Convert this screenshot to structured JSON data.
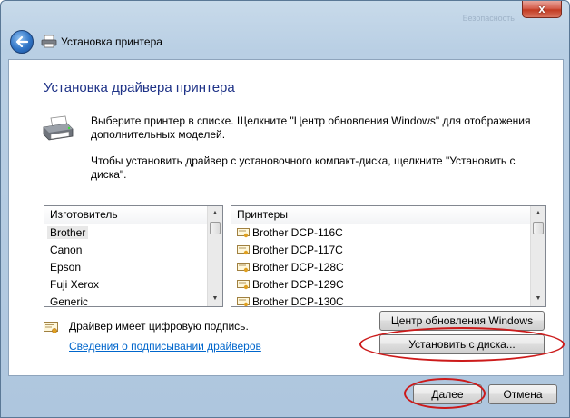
{
  "window": {
    "close_label": "x",
    "ghost_title": "Безопасность"
  },
  "nav": {
    "title": "Установка принтера"
  },
  "main": {
    "heading": "Установка драйвера принтера",
    "description_1": "Выберите принтер в списке. Щелкните \"Центр обновления Windows\" для отображения дополнительных моделей.",
    "description_2": "Чтобы установить драйвер с установочного компакт-диска, щелкните \"Установить с диска\"."
  },
  "manufacturers": {
    "header": "Изготовитель",
    "items": [
      "Brother",
      "Canon",
      "Epson",
      "Fuji Xerox",
      "Generic"
    ],
    "selected": "Brother"
  },
  "printers": {
    "header": "Принтеры",
    "items": [
      "Brother DCP-116C",
      "Brother DCP-117C",
      "Brother DCP-128C",
      "Brother DCP-129C",
      "Brother DCP-130C"
    ]
  },
  "signature": {
    "text": "Драйвер имеет цифровую подпись.",
    "link": "Сведения о подписывании драйверов"
  },
  "buttons": {
    "windows_update": "Центр обновления Windows",
    "have_disk": "Установить с диска...",
    "next": "Далее",
    "cancel": "Отмена"
  },
  "colors": {
    "heading": "#1e3287",
    "link": "#0066cc",
    "annotation": "#cc1a1a"
  }
}
